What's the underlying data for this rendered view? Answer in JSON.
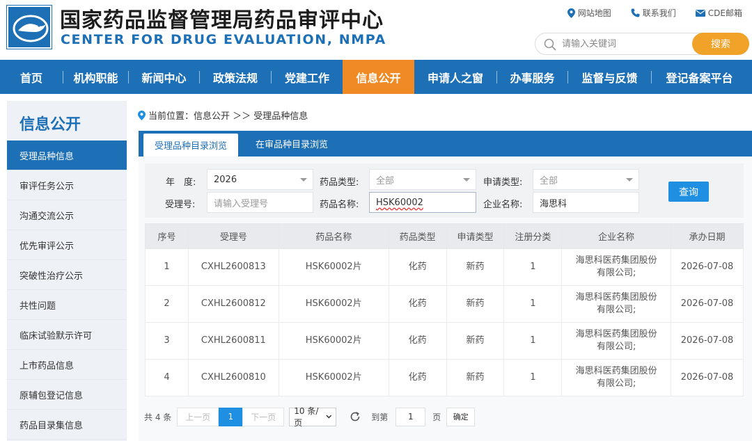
{
  "header": {
    "title_cn": "国家药品监督管理局药品审评中心",
    "title_en": "CENTER FOR DRUG EVALUATION, NMPA",
    "links": [
      {
        "label": "网站地图",
        "icon": "location-pin-icon"
      },
      {
        "label": "联系我们",
        "icon": "phone-icon"
      },
      {
        "label": "CDE邮箱",
        "icon": "mail-icon"
      }
    ],
    "search_placeholder": "请输入关键词",
    "search_button": "搜索"
  },
  "nav": {
    "items": [
      "首页",
      "机构职能",
      "新闻中心",
      "政策法规",
      "党建工作",
      "信息公开",
      "申请人之窗",
      "办事服务",
      "监督与反馈",
      "登记备案平台"
    ],
    "active_index": 5
  },
  "sidebar": {
    "title": "信息公开",
    "items": [
      "受理品种信息",
      "审评任务公示",
      "沟通交流公示",
      "优先审评公示",
      "突破性治疗公示",
      "共性问题",
      "临床试验默示许可",
      "上市药品信息",
      "原辅包登记信息",
      "药品目录集信息"
    ],
    "active_index": 0
  },
  "breadcrumb": {
    "label": "当前位置：信息公开 ＞＞ 受理品种信息"
  },
  "tabs": {
    "items": [
      "受理品种目录浏览",
      "在审品种目录浏览"
    ],
    "active_index": 0
  },
  "filters": {
    "year_label": "年　度:",
    "year_value": "2026",
    "drug_type_label": "药品类型:",
    "drug_type_value": "全部",
    "apply_type_label": "申请类型:",
    "apply_type_value": "全部",
    "accept_no_label": "受理号:",
    "accept_no_placeholder": "请输入受理号",
    "drug_name_label": "药品名称:",
    "drug_name_value": "HSK60002",
    "company_label": "企业名称:",
    "company_value": "海思科",
    "query_button": "查询"
  },
  "table": {
    "headers": [
      "序号",
      "受理号",
      "药品名称",
      "药品类型",
      "申请类型",
      "注册分类",
      "企业名称",
      "承办日期"
    ],
    "rows": [
      [
        "1",
        "CXHL2600813",
        "HSK60002片",
        "化药",
        "新药",
        "1",
        "海思科医药集团股份有限公司;",
        "2026-07-08"
      ],
      [
        "2",
        "CXHL2600812",
        "HSK60002片",
        "化药",
        "新药",
        "1",
        "海思科医药集团股份有限公司;",
        "2026-07-08"
      ],
      [
        "3",
        "CXHL2600811",
        "HSK60002片",
        "化药",
        "新药",
        "1",
        "海思科医药集团股份有限公司;",
        "2026-07-08"
      ],
      [
        "4",
        "CXHL2600810",
        "HSK60002片",
        "化药",
        "新药",
        "1",
        "海思科医药集团股份有限公司;",
        "2026-07-08"
      ]
    ]
  },
  "pager": {
    "total": "共 4 条",
    "prev": "上一页",
    "current": "1",
    "next": "下一页",
    "page_size": "10 条/页",
    "goto_label": "到第",
    "goto_value": "1",
    "page_unit": "页",
    "confirm": "确定"
  },
  "colors": {
    "brand_blue": "#1d6fb6",
    "accent_orange": "#f08a24",
    "search_orange": "#f0a229",
    "button_blue": "#1e8fe1"
  }
}
